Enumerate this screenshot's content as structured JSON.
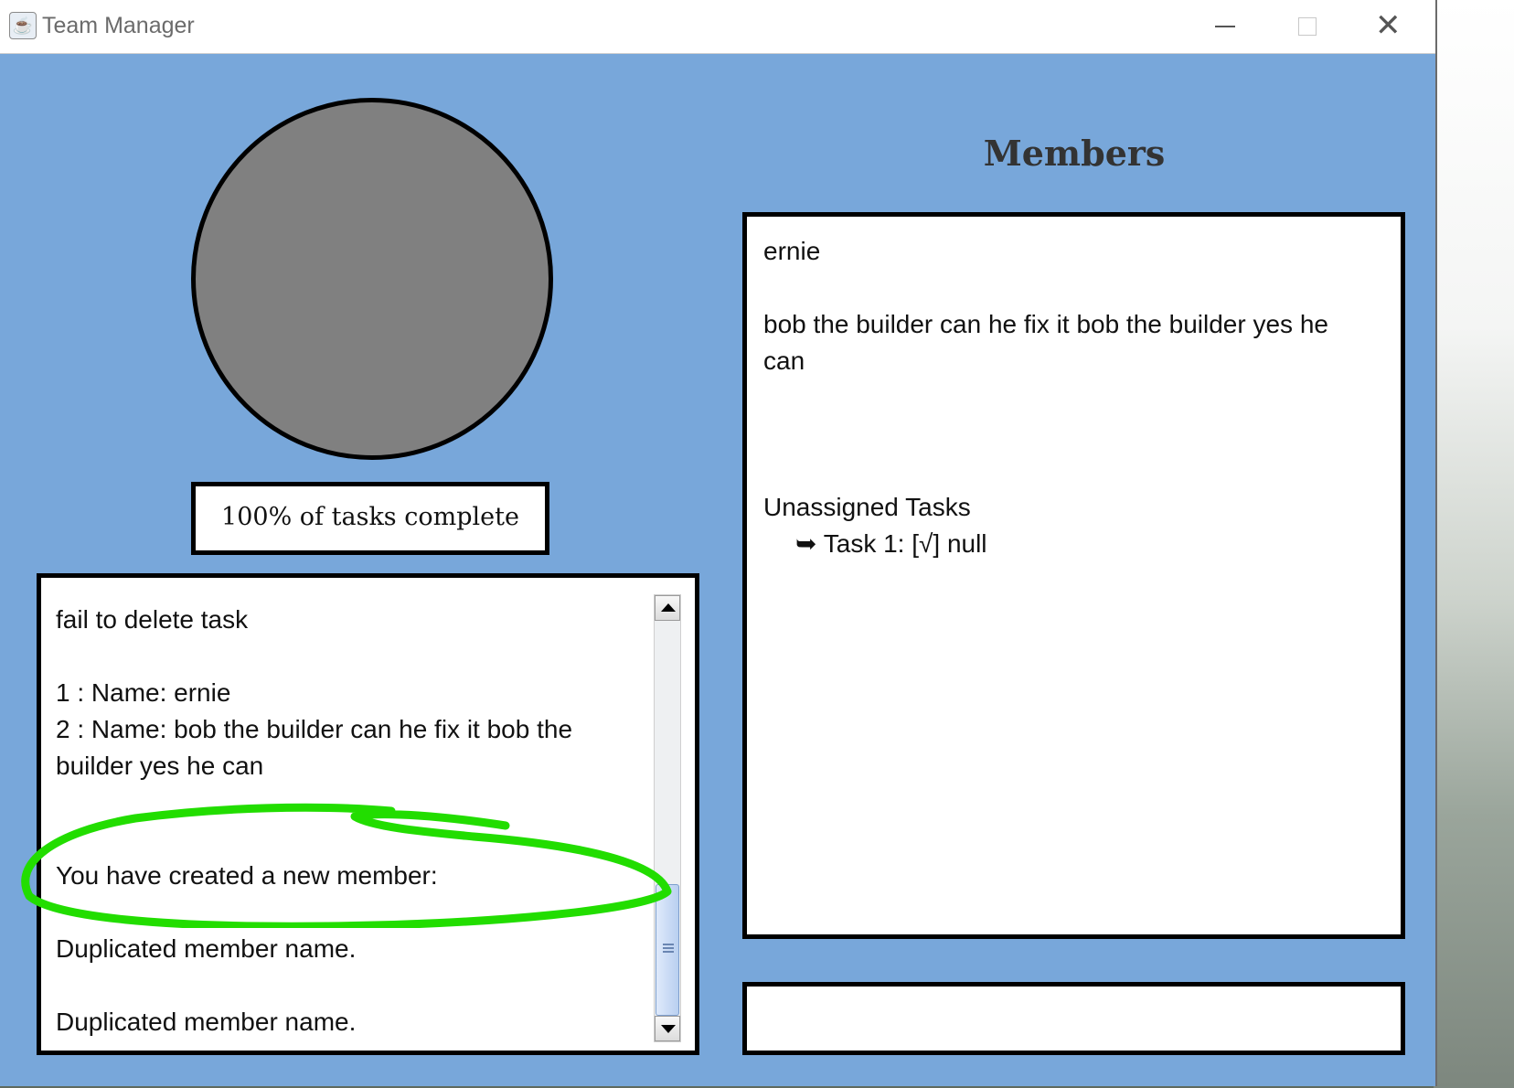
{
  "window": {
    "title": "Team Manager"
  },
  "progress": {
    "percent": 100,
    "label": "100% of tasks complete"
  },
  "log": {
    "lines": [
      "fail to delete task",
      "",
      "1 : Name: ernie",
      "2 : Name: bob the builder can he fix it bob the builder yes he can",
      "",
      "",
      "You have created a new member:",
      "",
      "Duplicated member name.",
      "",
      "Duplicated member name."
    ]
  },
  "members": {
    "heading": "Members",
    "names": [
      "ernie",
      "bob the builder can he fix it bob the builder yes he can"
    ],
    "unassigned_heading": "Unassigned Tasks",
    "tasks": [
      {
        "arrow": "➥",
        "text": "Task 1: [√] null"
      }
    ]
  },
  "input": {
    "value": ""
  },
  "colors": {
    "background": "#78a7da",
    "highlight": "#22dd00"
  }
}
